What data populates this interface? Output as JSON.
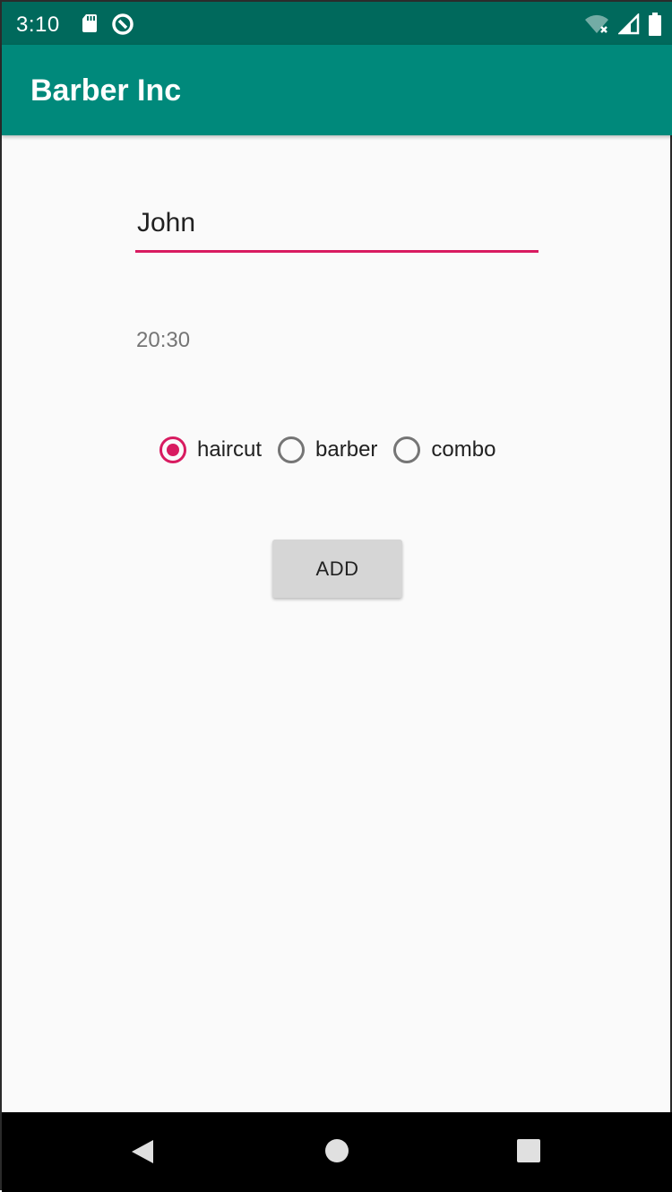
{
  "status_bar": {
    "time": "3:10",
    "icons": [
      "sd-card-icon",
      "sync-icon",
      "wifi-icon",
      "signal-icon",
      "battery-icon"
    ]
  },
  "app_bar": {
    "title": "Barber Inc"
  },
  "form": {
    "name_value": "John",
    "time_text": "20:30",
    "service_options": [
      {
        "label": "haircut",
        "checked": true
      },
      {
        "label": "barber",
        "checked": false
      },
      {
        "label": "combo",
        "checked": false
      }
    ],
    "add_label": "ADD"
  },
  "nav_bar": {
    "icons": [
      "back-icon",
      "home-icon",
      "recents-icon"
    ]
  },
  "colors": {
    "status_bar": "#00695c",
    "app_bar": "#00897b",
    "accent": "#d81b60",
    "background": "#fafafa"
  }
}
